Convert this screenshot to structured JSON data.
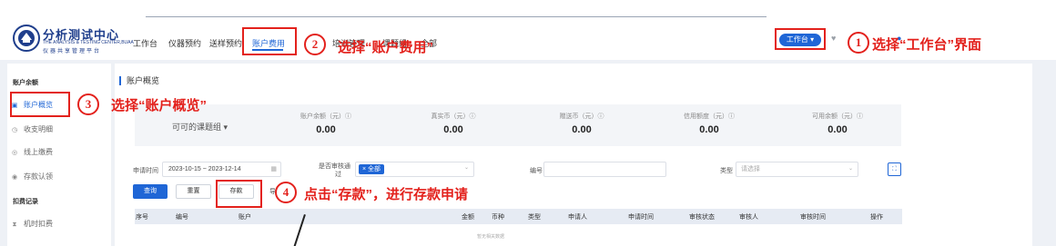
{
  "header": {
    "brand_cn": "分析测试中心",
    "brand_en": "THE ANALYSIS & TESTING CENTER,BUAA",
    "brand_sub": "仪器共享管理平台",
    "nav": [
      "工作台",
      "仪器预约",
      "送样预约",
      "账户费用",
      "培训管理",
      "课题组",
      "全部"
    ],
    "workspace_label": "工作台 ▾"
  },
  "annotations": {
    "step1": "1",
    "step1_text": "选择“工作台”界面",
    "step2": "2",
    "step2_text": "选择“账户费用”",
    "step3": "3",
    "step3_text": "选择“账户概览”",
    "step4": "4",
    "step4_text": "点击“存款”，进行存款申请"
  },
  "sidebar": {
    "section1": "账户余额",
    "items1": [
      "账户概览",
      "收支明细",
      "线上缴费",
      "存款认领"
    ],
    "section2": "扣费记录",
    "items2": [
      "机时扣费"
    ]
  },
  "page_title": "账户概览",
  "summary": {
    "group_select": "可可的课题组 ▾",
    "stats": [
      {
        "label": "账户余额（元）ⓘ",
        "value": "0.00"
      },
      {
        "label": "真实币（元）ⓘ",
        "value": "0.00"
      },
      {
        "label": "赠送币（元）ⓘ",
        "value": "0.00"
      },
      {
        "label": "信用额度（元）ⓘ",
        "value": "0.00"
      },
      {
        "label": "可用余额（元）ⓘ",
        "value": "0.00"
      }
    ]
  },
  "filters": {
    "date_label": "申请时间",
    "date_value": "2023-10-15 ~ 2023-12-14",
    "audit_label_1": "是否审核通",
    "audit_label_2": "过",
    "audit_tag": "× 全部",
    "number_label": "编号",
    "type_label": "类型",
    "type_placeholder": "请选择"
  },
  "buttons": {
    "query": "查询",
    "reset": "重置",
    "deposit": "存款",
    "export": "导"
  },
  "table": {
    "headers": [
      "序号",
      "编号",
      "账户",
      "金额",
      "币种",
      "类型",
      "申请人",
      "申请时间",
      "审核状态",
      "审核人",
      "审核时间",
      "操作"
    ],
    "empty": "暂无相关数据"
  }
}
